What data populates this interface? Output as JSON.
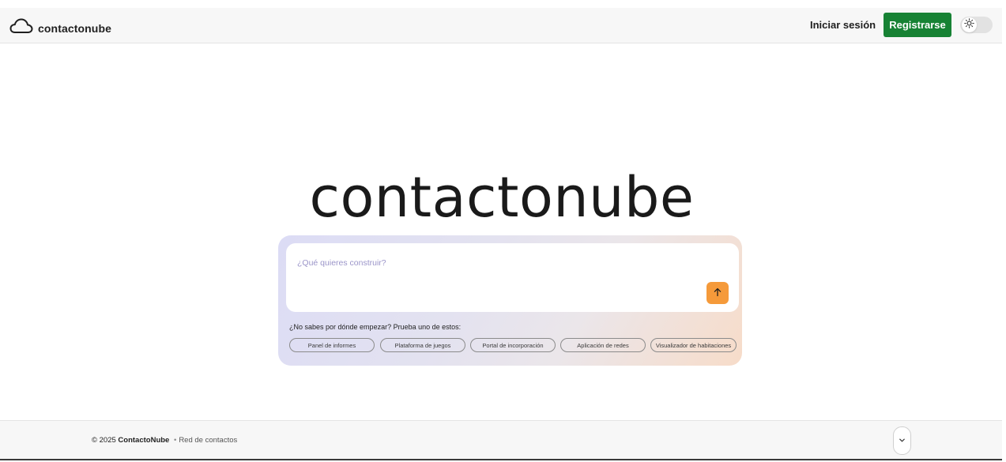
{
  "header": {
    "brand_name": "contactonube",
    "login_label": "Iniciar sesión",
    "register_label": "Registrarse",
    "theme_toggle_icon": "sun-icon",
    "accent_color": "#178234"
  },
  "hero": {
    "title": "contactonube"
  },
  "prompt": {
    "placeholder": "¿Qué quieres construir?",
    "value": "",
    "send_icon": "arrow-up-icon",
    "send_color": "#f59a3a",
    "hint": "¿No sabes por dónde empezar? Prueba uno de estos:",
    "suggestions": [
      "Panel de informes",
      "Plataforma de juegos",
      "Portal de incorporación",
      "Aplicación de redes",
      "Visualizador de habitaciones"
    ]
  },
  "footer": {
    "copyright_prefix": "© 2025",
    "company": "ContactoNube",
    "separator": "•",
    "tagline": "Red de contactos",
    "scroll_icon": "chevron-down-icon"
  }
}
